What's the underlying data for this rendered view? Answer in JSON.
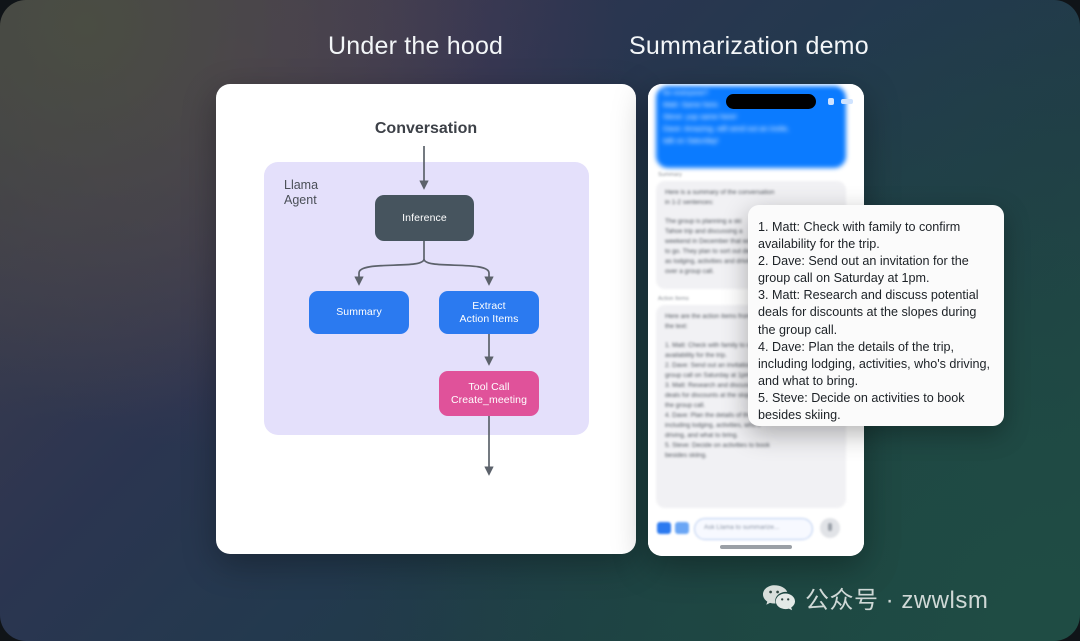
{
  "headings": {
    "left": "Under the hood",
    "right": "Summarization demo"
  },
  "diagram": {
    "input_label": "Conversation",
    "agent_label": "Llama\nAgent",
    "nodes": {
      "inference": "Inference",
      "summary": "Summary",
      "extract": "Extract\nAction Items",
      "tool_call": "Tool Call\nCreate_meeting"
    },
    "colors": {
      "inference_bg": "#46545e",
      "blue_bg": "#2b7af0",
      "pink_bg": "#e0529a",
      "panel_bg": "#e4e0fb",
      "card_bg": "#ffffff"
    }
  },
  "phone": {
    "chat_lines": [
      "for everyone?",
      "Matt: Same here.",
      "Steve: yup same here!",
      "Dave: Amazing, will send out an invite,",
      "talk on Saturday!"
    ],
    "summary_section_label": "Summary",
    "summary_card_lines": [
      "Here is a summary of the conversation",
      "in 1-2 sentences:",
      "",
      "The group is planning a ski",
      "Tahoe trip and discussing a",
      "weekend in December that works",
      "to go. They plan to sort out details",
      "as lodging, activities and driving",
      "over a group call."
    ],
    "action_section_label": "Action Items",
    "action_card_lines": [
      "Here are the action items from",
      "the text:",
      "",
      "1. Matt: Check with family to confirm",
      "availability for the trip.",
      "2. Dave: Send out an invitation for the",
      "group call on Saturday at 1pm.",
      "3. Matt: Research and discuss potential",
      "deals for discounts at the slopes during",
      "the group call.",
      "4. Dave: Plan the details of the trip,",
      "including lodging, activities, who's",
      "driving, and what to bring.",
      "5. Steve: Decide on activities to book",
      "besides skiing."
    ],
    "input_placeholder": "Ask Llama to summarize..."
  },
  "summary_popup": {
    "text": "1. Matt: Check with family to confirm availability for the trip.\n2. Dave: Send out an invitation for the group call on Saturday at 1pm.\n3. Matt: Research and discuss potential deals for discounts at the slopes during the group call.\n4. Dave: Plan the details of the trip, including lodging, activities, who's driving, and what to bring.\n5. Steve: Decide on activities to book besides skiing."
  },
  "watermark": {
    "text": "公众号 · zwwlsm",
    "icon": "wechat-icon"
  }
}
